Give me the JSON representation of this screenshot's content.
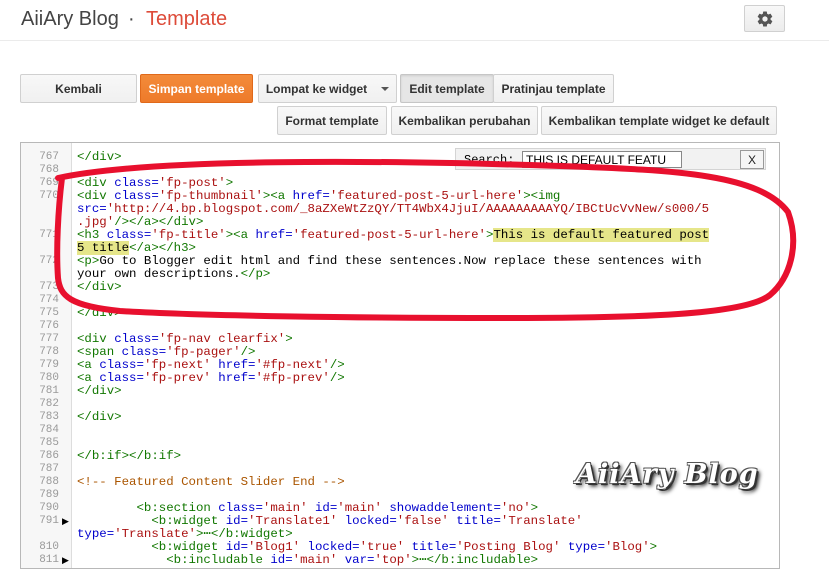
{
  "header": {
    "blog_name": "AiiAry Blog",
    "separator": "·",
    "page_title": "Template",
    "settings_icon": "gear-icon"
  },
  "toolbar": {
    "back": "Kembali",
    "save": "Simpan template",
    "jump": "Lompat ke widget",
    "edit": "Edit template",
    "preview": "Pratinjau template",
    "format": "Format template",
    "revert": "Kembalikan perubahan",
    "revert_widgets": "Kembalikan template widget ke default"
  },
  "search": {
    "label": "Search:",
    "value": "THIS IS DEFAULT FEATU",
    "close": "X"
  },
  "editor": {
    "lines": [
      {
        "n": "767",
        "segments": [
          {
            "t": "</div>",
            "c": "tag"
          }
        ]
      },
      {
        "n": "768",
        "segments": []
      },
      {
        "n": "769",
        "segments": [
          {
            "t": "<div ",
            "c": "tag"
          },
          {
            "t": "class=",
            "c": "attr"
          },
          {
            "t": "'fp-post'",
            "c": "val"
          },
          {
            "t": ">",
            "c": "tag"
          }
        ]
      },
      {
        "n": "770",
        "segments": [
          {
            "t": "<div ",
            "c": "tag"
          },
          {
            "t": "class=",
            "c": "attr"
          },
          {
            "t": "'fp-thumbnail'",
            "c": "val"
          },
          {
            "t": "><a ",
            "c": "tag"
          },
          {
            "t": "href=",
            "c": "attr"
          },
          {
            "t": "'featured-post-5-url-here'",
            "c": "val"
          },
          {
            "t": "><img",
            "c": "tag"
          }
        ]
      },
      {
        "n": "",
        "segments": [
          {
            "t": "src=",
            "c": "attr"
          },
          {
            "t": "'http://4.bp.blogspot.com/_8aZXeWtZzQY/TT4WbX4JjuI/AAAAAAAAAYQ/IBCtUcVvNew/s000/5",
            "c": "val"
          }
        ]
      },
      {
        "n": "",
        "segments": [
          {
            "t": ".jpg'",
            "c": "val"
          },
          {
            "t": "/></a></div>",
            "c": "tag"
          }
        ]
      },
      {
        "n": "771",
        "segments": [
          {
            "t": "<h3 ",
            "c": "tag"
          },
          {
            "t": "class=",
            "c": "attr"
          },
          {
            "t": "'fp-title'",
            "c": "val"
          },
          {
            "t": "><a ",
            "c": "tag"
          },
          {
            "t": "href=",
            "c": "attr"
          },
          {
            "t": "'featured-post-5-url-here'",
            "c": "val"
          },
          {
            "t": ">",
            "c": "tag"
          },
          {
            "t": "This is default featured post",
            "c": "txt hl"
          }
        ]
      },
      {
        "n": "",
        "segments": [
          {
            "t": "5 title",
            "c": "txt hl"
          },
          {
            "t": "</a></h3>",
            "c": "tag"
          }
        ]
      },
      {
        "n": "772",
        "segments": [
          {
            "t": "<p>",
            "c": "tag"
          },
          {
            "t": "Go to Blogger edit html and find these sentences.Now replace these sentences with",
            "c": "txt"
          }
        ]
      },
      {
        "n": "",
        "segments": [
          {
            "t": "your own descriptions.",
            "c": "txt"
          },
          {
            "t": "</p>",
            "c": "tag"
          }
        ]
      },
      {
        "n": "773",
        "segments": [
          {
            "t": "</div>",
            "c": "tag"
          }
        ]
      },
      {
        "n": "774",
        "segments": []
      },
      {
        "n": "775",
        "segments": [
          {
            "t": "</div>",
            "c": "tag"
          }
        ]
      },
      {
        "n": "776",
        "segments": []
      },
      {
        "n": "777",
        "segments": [
          {
            "t": "<div ",
            "c": "tag"
          },
          {
            "t": "class=",
            "c": "attr"
          },
          {
            "t": "'fp-nav clearfix'",
            "c": "val"
          },
          {
            "t": ">",
            "c": "tag"
          }
        ]
      },
      {
        "n": "778",
        "segments": [
          {
            "t": "<span ",
            "c": "tag"
          },
          {
            "t": "class=",
            "c": "attr"
          },
          {
            "t": "'fp-pager'",
            "c": "val"
          },
          {
            "t": "/>",
            "c": "tag"
          }
        ]
      },
      {
        "n": "779",
        "segments": [
          {
            "t": "<a ",
            "c": "tag"
          },
          {
            "t": "class=",
            "c": "attr"
          },
          {
            "t": "'fp-next' ",
            "c": "val"
          },
          {
            "t": "href=",
            "c": "attr"
          },
          {
            "t": "'#fp-next'",
            "c": "val"
          },
          {
            "t": "/>",
            "c": "tag"
          }
        ]
      },
      {
        "n": "780",
        "segments": [
          {
            "t": "<a ",
            "c": "tag"
          },
          {
            "t": "class=",
            "c": "attr"
          },
          {
            "t": "'fp-prev' ",
            "c": "val"
          },
          {
            "t": "href=",
            "c": "attr"
          },
          {
            "t": "'#fp-prev'",
            "c": "val"
          },
          {
            "t": "/>",
            "c": "tag"
          }
        ]
      },
      {
        "n": "781",
        "segments": [
          {
            "t": "</div>",
            "c": "tag"
          }
        ]
      },
      {
        "n": "782",
        "segments": []
      },
      {
        "n": "783",
        "segments": [
          {
            "t": "</div>",
            "c": "tag"
          }
        ]
      },
      {
        "n": "784",
        "segments": []
      },
      {
        "n": "785",
        "segments": []
      },
      {
        "n": "786",
        "segments": [
          {
            "t": "</b:if></b:if>",
            "c": "tag"
          }
        ]
      },
      {
        "n": "787",
        "segments": []
      },
      {
        "n": "788",
        "segments": [
          {
            "t": "<!-- Featured Content Slider End -->",
            "c": "cmt"
          }
        ]
      },
      {
        "n": "789",
        "segments": []
      },
      {
        "n": "790",
        "segments": [
          {
            "t": "        <b:section ",
            "c": "tag"
          },
          {
            "t": "class=",
            "c": "attr"
          },
          {
            "t": "'main' ",
            "c": "val"
          },
          {
            "t": "id=",
            "c": "attr"
          },
          {
            "t": "'main' ",
            "c": "val"
          },
          {
            "t": "showaddelement=",
            "c": "attr"
          },
          {
            "t": "'no'",
            "c": "val"
          },
          {
            "t": ">",
            "c": "tag"
          }
        ]
      },
      {
        "n": "791",
        "fold": true,
        "segments": [
          {
            "t": "          <b:widget ",
            "c": "tag"
          },
          {
            "t": "id=",
            "c": "attr"
          },
          {
            "t": "'Translate1' ",
            "c": "val"
          },
          {
            "t": "locked=",
            "c": "attr"
          },
          {
            "t": "'false' ",
            "c": "val"
          },
          {
            "t": "title=",
            "c": "attr"
          },
          {
            "t": "'Translate'",
            "c": "val"
          }
        ]
      },
      {
        "n": "",
        "segments": [
          {
            "t": "type=",
            "c": "attr"
          },
          {
            "t": "'Translate'",
            "c": "val"
          },
          {
            "t": ">⋯</b:widget>",
            "c": "tag"
          }
        ]
      },
      {
        "n": "810",
        "segments": [
          {
            "t": "          <b:widget ",
            "c": "tag"
          },
          {
            "t": "id=",
            "c": "attr"
          },
          {
            "t": "'Blog1' ",
            "c": "val"
          },
          {
            "t": "locked=",
            "c": "attr"
          },
          {
            "t": "'true' ",
            "c": "val"
          },
          {
            "t": "title=",
            "c": "attr"
          },
          {
            "t": "'Posting Blog' ",
            "c": "val"
          },
          {
            "t": "type=",
            "c": "attr"
          },
          {
            "t": "'Blog'",
            "c": "val"
          },
          {
            "t": ">",
            "c": "tag"
          }
        ]
      },
      {
        "n": "811",
        "fold": true,
        "segments": [
          {
            "t": "            <b:includable ",
            "c": "tag"
          },
          {
            "t": "id=",
            "c": "attr"
          },
          {
            "t": "'main' ",
            "c": "val"
          },
          {
            "t": "var=",
            "c": "attr"
          },
          {
            "t": "'top'",
            "c": "val"
          },
          {
            "t": ">⋯</b:includable>",
            "c": "tag"
          }
        ]
      }
    ]
  },
  "watermark": "AiiAry Blog",
  "colors": {
    "accent": "#dd4b39",
    "save_button": "#f08232",
    "annotation": "#e8102e"
  }
}
